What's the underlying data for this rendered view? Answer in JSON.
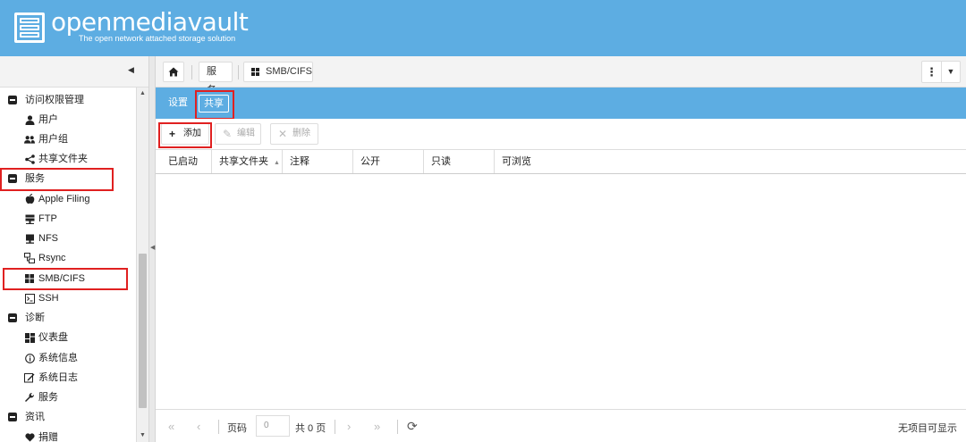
{
  "header": {
    "app_name": "openmediavault",
    "tagline": "The open network attached storage solution"
  },
  "sidebar": {
    "collapse_icon": "chevron-left-icon",
    "items": [
      {
        "label": "访问权限管理",
        "type": "group",
        "icon": "minus-square-icon"
      },
      {
        "label": "用户",
        "type": "child",
        "icon": "user-icon"
      },
      {
        "label": "用户组",
        "type": "child",
        "icon": "users-icon"
      },
      {
        "label": "共享文件夹",
        "type": "child",
        "icon": "share-icon"
      },
      {
        "label": "服务",
        "type": "group",
        "icon": "minus-square-icon"
      },
      {
        "label": "Apple Filing",
        "type": "child",
        "icon": "apple-icon"
      },
      {
        "label": "FTP",
        "type": "child",
        "icon": "ftp-icon"
      },
      {
        "label": "NFS",
        "type": "child",
        "icon": "nfs-icon"
      },
      {
        "label": "Rsync",
        "type": "child",
        "icon": "rsync-icon"
      },
      {
        "label": "SMB/CIFS",
        "type": "child",
        "icon": "windows-icon"
      },
      {
        "label": "SSH",
        "type": "child",
        "icon": "terminal-icon"
      },
      {
        "label": "诊断",
        "type": "group",
        "icon": "minus-square-icon"
      },
      {
        "label": "仪表盘",
        "type": "child",
        "icon": "dashboard-icon"
      },
      {
        "label": "系统信息",
        "type": "child",
        "icon": "info-icon"
      },
      {
        "label": "系统日志",
        "type": "child",
        "icon": "edit-icon"
      },
      {
        "label": "服务",
        "type": "child",
        "icon": "wrench-icon"
      },
      {
        "label": "资讯",
        "type": "group",
        "icon": "minus-square-icon"
      },
      {
        "label": "捐赠",
        "type": "child",
        "icon": "heart-icon"
      }
    ]
  },
  "breadcrumb": {
    "home_icon": "home-icon",
    "services": "服务",
    "current": "SMB/CIFS"
  },
  "tabs": {
    "settings": "设置",
    "shares": "共享"
  },
  "toolbar": {
    "add": "添加",
    "edit": "编辑",
    "delete": "删除"
  },
  "grid": {
    "columns": [
      "已启动",
      "共享文件夹",
      "注释",
      "公开",
      "只读",
      "可浏览"
    ]
  },
  "pager": {
    "page_label": "页码",
    "page_value": "0",
    "of_pages": "共 0 页",
    "status": "无项目可显示"
  },
  "colors": {
    "brand_blue": "#5dade2",
    "highlight_red": "#e02020"
  }
}
